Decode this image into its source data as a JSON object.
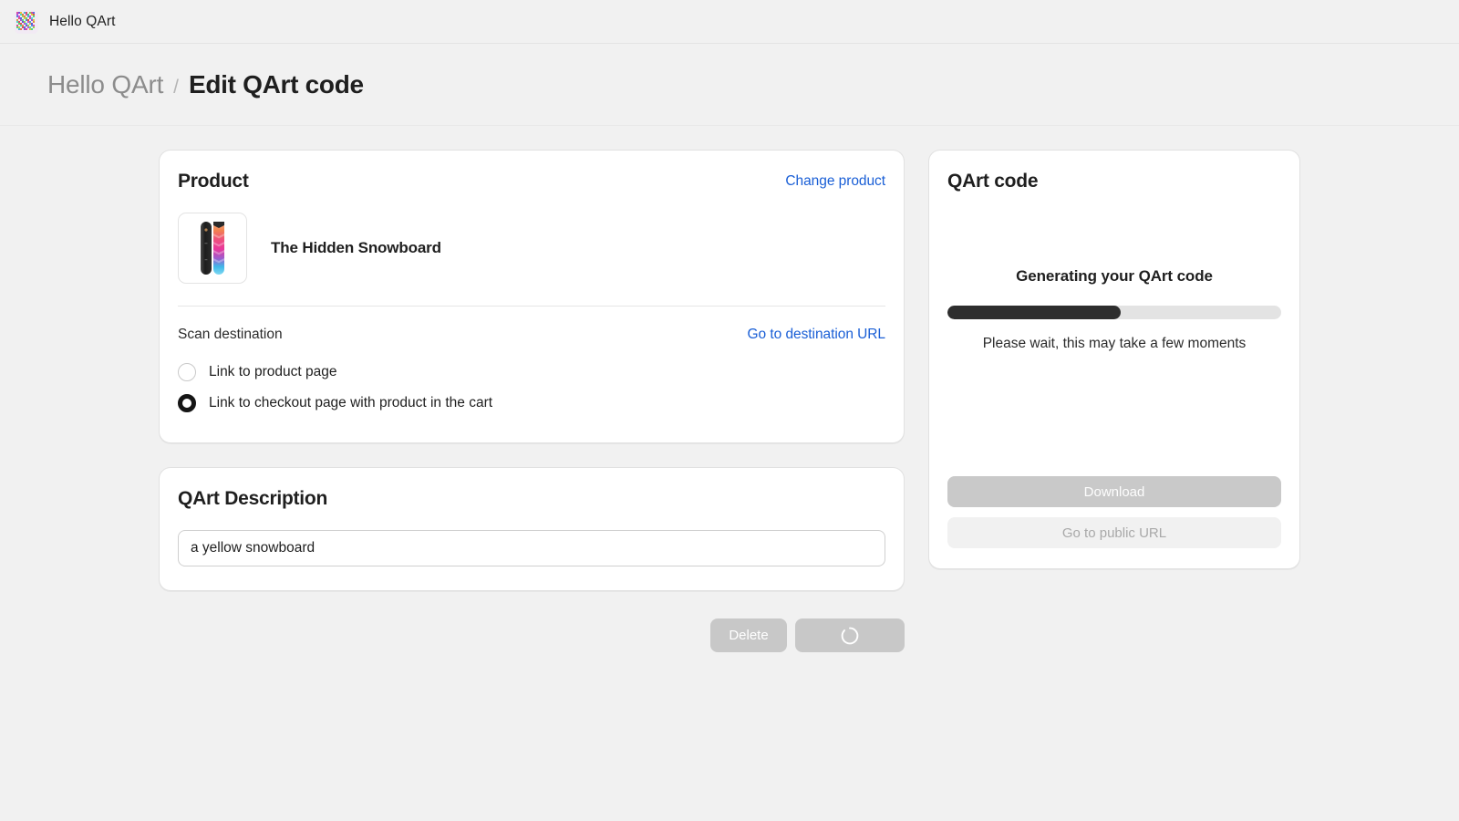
{
  "appbar": {
    "title": "Hello QArt",
    "icon": "qart-logo-icon"
  },
  "breadcrumb": {
    "root": "Hello QArt",
    "separator": "/",
    "current": "Edit QArt code"
  },
  "product_card": {
    "title": "Product",
    "change_link": "Change product",
    "product_name": "The Hidden Snowboard",
    "thumbnail_alt": "snowboard-thumbnail",
    "scan_destination": {
      "label": "Scan destination",
      "destination_link": "Go to destination URL",
      "options": [
        {
          "label": "Link to product page",
          "selected": false
        },
        {
          "label": "Link to checkout page with product in the cart",
          "selected": true
        }
      ]
    }
  },
  "description_card": {
    "title": "QArt Description",
    "input_value": "a yellow snowboard",
    "input_placeholder": "Describe your QArt code"
  },
  "footer_actions": {
    "delete_label": "Delete",
    "save_label": "",
    "save_state": "loading",
    "spinner_icon": "spinner-icon"
  },
  "qart_card": {
    "title": "QArt code",
    "generating_heading": "Generating your QArt code",
    "wait_message": "Please wait, this may take a few moments",
    "progress_percent": 52,
    "download_label": "Download",
    "public_url_label": "Go to public URL"
  },
  "colors": {
    "page_background": "#f1f1f1",
    "card_background": "#ffffff",
    "link_blue": "#1a5fd6",
    "progress_fill": "#2e2e2e",
    "progress_track": "#e3e3e3",
    "disabled_button": "#c8c8c8",
    "text_primary": "#1f1f1f",
    "text_muted": "#8c8c8c"
  }
}
